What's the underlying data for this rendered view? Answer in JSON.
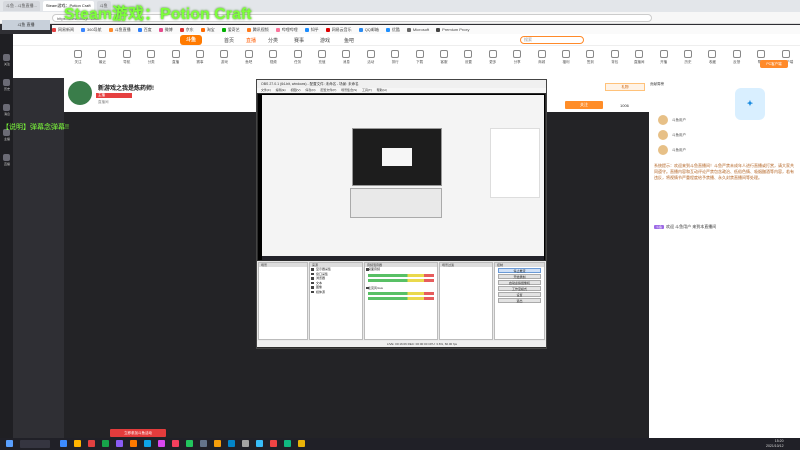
{
  "overlay": {
    "title": "Steam游戏：Potion Craft",
    "danmu": "【说明】弹幕念弹幕!!",
    "badge": "斗鱼 直播"
  },
  "browser": {
    "tabs": [
      {
        "label": "斗鱼 - 斗鱼直播...",
        "active": false
      },
      {
        "label": "Steam游戏：Potion Craft",
        "active": true
      },
      {
        "label": "斗鱼",
        "active": false
      }
    ],
    "url": "https://www.douyu.com/..."
  },
  "bookmarks": [
    "网易新闻",
    "360导航",
    "斗鱼直播",
    "百度",
    "微博",
    "京东",
    "淘宝",
    "爱奇艺",
    "腾讯视频",
    "哔哩哔哩",
    "知乎",
    "网易云音乐",
    "QQ邮箱",
    "优酷",
    "Microsoft",
    "Premium Proxy"
  ],
  "site_nav": {
    "logo": "斗鱼",
    "items": [
      {
        "label": "首页",
        "active": false
      },
      {
        "label": "直播",
        "active": true
      },
      {
        "label": "分类",
        "active": false
      },
      {
        "label": "赛事",
        "active": false
      },
      {
        "label": "游戏",
        "active": false
      },
      {
        "label": "鱼吧",
        "active": false
      }
    ],
    "search_placeholder": "搜索"
  },
  "categories": [
    "关注",
    "最近",
    "导航",
    "分类",
    "直播",
    "赛事",
    "游戏",
    "鱼吧",
    "视频",
    "任务",
    "充值",
    "消息",
    "活动",
    "排行",
    "下载",
    "客服",
    "设置",
    "更多",
    "分享",
    "商城",
    "福利",
    "签到",
    "背包",
    "直播间",
    "开播",
    "历史",
    "收藏",
    "反馈",
    "帮助",
    "PC客户端"
  ],
  "room": {
    "title": "新游戏之我是炼药师!",
    "streamer_tag": "主播",
    "subtitle": "直播间",
    "follow_label": "关注",
    "follow_count": "1006",
    "gift_label": "礼物"
  },
  "obs": {
    "title": "OBS 27.0.1 (64-bit, windows) - 配置文件: 未命名 - 场景: 未命名",
    "menu": "文件(F) 编辑(E) 视图(V) 停靠(D) 配置文件(P) 场景集合(S) 工具(T) 帮助(H)",
    "docks": {
      "scenes": "场景",
      "sources": "来源",
      "mixer": "音频混音器",
      "transitions": "场景过渡",
      "controls": "控制"
    },
    "sources": [
      "显示器采集",
      "窗口采集",
      "浏览器",
      "文本",
      "图像",
      "媒体源"
    ],
    "mixer_tracks": [
      "桌面音频",
      "麦克风/Aux"
    ],
    "controls": [
      {
        "label": "停止推流",
        "active": true
      },
      {
        "label": "开始录制",
        "active": false
      },
      {
        "label": "启动虚拟摄像机",
        "active": false
      },
      {
        "label": "工作室模式",
        "active": false
      },
      {
        "label": "设置",
        "active": false
      },
      {
        "label": "退出",
        "active": false
      }
    ],
    "status": "LIVE: 00:16:06   REC: 00:00:00   CPU: 3.6%, 60.00 fps"
  },
  "rank": {
    "tabs": "贡献周榜",
    "rows": [
      "斗鱼用户",
      "斗鱼用户",
      "斗鱼用户"
    ],
    "notice": "系统提示：欢迎来到斗鱼直播间！斗鱼严禁未成年人进行直播或打赏，请大家共同遵守。直播内容和互动评论严禁包含政治、低俗色情、吸烟酗酒等内容，若有违反，将视情节严重程度给予禁播、永久封禁直播间等处理。",
    "chat_tag": "斗鱼",
    "chat_line": "欢迎 斗鱼用户 来到本直播间"
  },
  "pc_button": "PC客户端",
  "promo_button": "立即参加斗鱼活动",
  "taskbar": {
    "time": "15:20",
    "date": "2021/10/12"
  },
  "rail": [
    "关注",
    "历史",
    "消息",
    "主播",
    "直播"
  ]
}
